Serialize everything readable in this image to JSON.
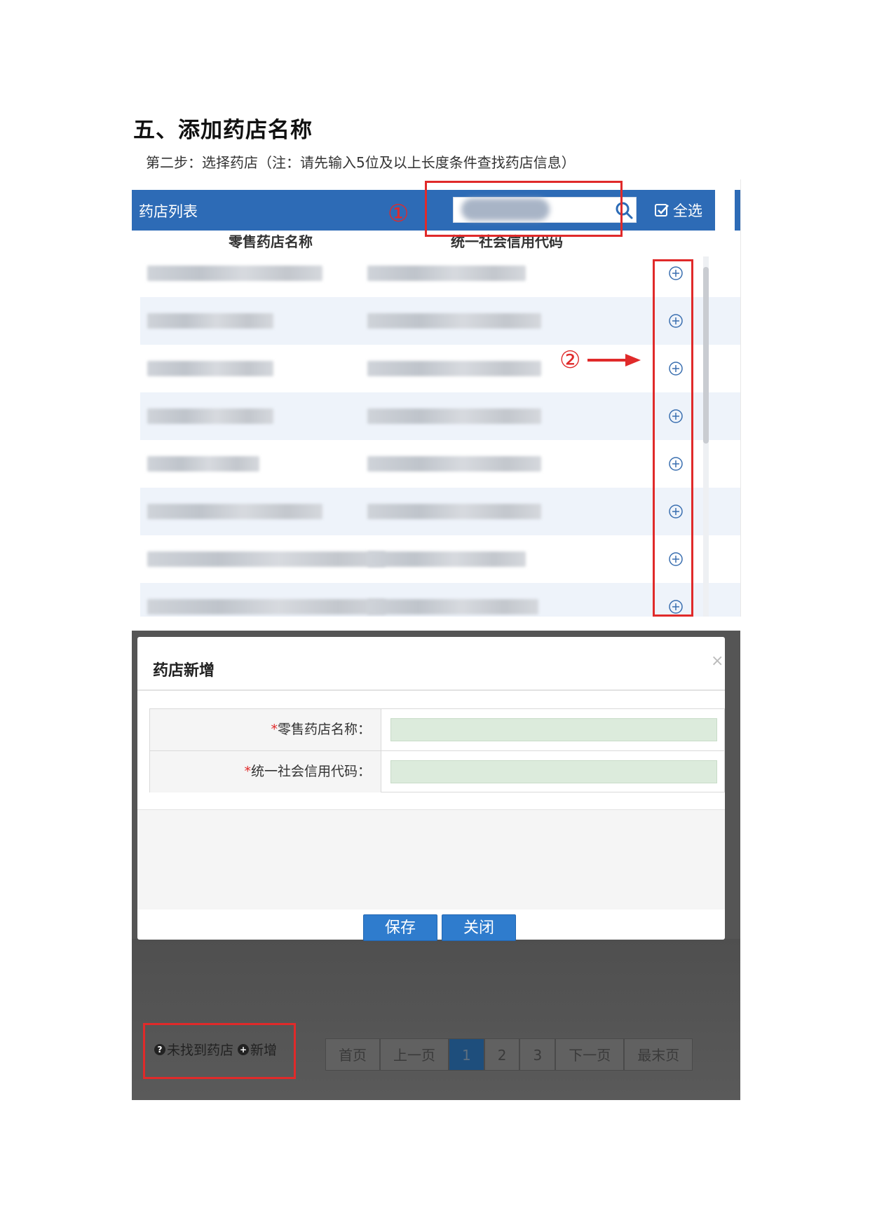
{
  "document": {
    "section_title": "五、添加药店名称",
    "step_caption": "第二步：选择药店（注：请先输入5位及以上长度条件查找药店信息）"
  },
  "pharmacy_list": {
    "panel_title": "药店列表",
    "select_all_label": "全选",
    "columns": [
      "零售药店名称",
      "统一社会信用代码"
    ],
    "markers": [
      "①",
      "②"
    ]
  },
  "add_pharmacy_dialog": {
    "title": "药店新增",
    "close_glyph": "×",
    "fields": [
      {
        "required_mark": "*",
        "label": "零售药店名称：",
        "value": ""
      },
      {
        "required_mark": "*",
        "label": "统一社会信用代码：",
        "value": ""
      }
    ],
    "buttons": {
      "save": "保存",
      "close": "关闭"
    }
  },
  "footer": {
    "not_found_text": "未找到药店",
    "add_new_text": "新增",
    "pagination": [
      "首页",
      "上一页",
      "1",
      "2",
      "3",
      "下一页",
      "最末页"
    ]
  },
  "colors": {
    "header_blue": "#2d6bb6",
    "annotation_red": "#e02a2a",
    "button_blue": "#2f7ccd"
  }
}
